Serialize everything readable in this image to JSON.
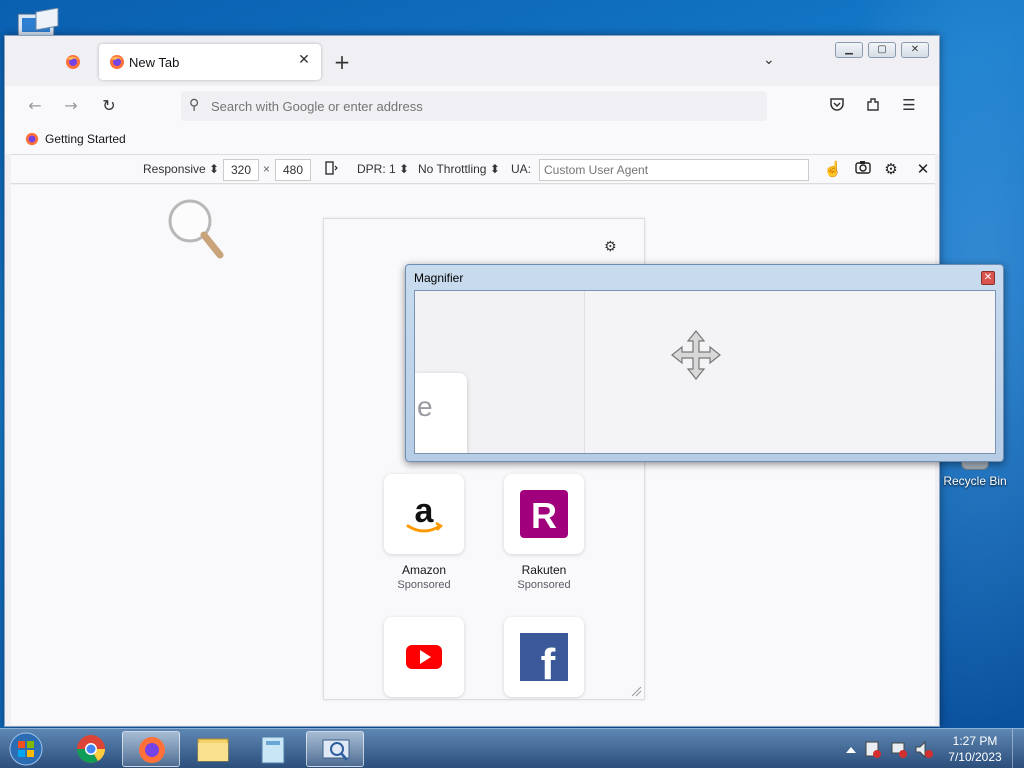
{
  "browser": {
    "tabs": [
      {
        "label": ""
      },
      {
        "label": "New Tab",
        "active": true
      }
    ],
    "new_tab_symbol": "+",
    "urlbar": {
      "placeholder": "Search with Google or enter address",
      "value": ""
    },
    "bookmarks": [
      {
        "label": "Getting Started"
      }
    ],
    "window_controls": [
      "minimize",
      "maximize",
      "close"
    ]
  },
  "responsive_toolbar": {
    "device": "Responsive",
    "width": "320",
    "times": "×",
    "height": "480",
    "dpr": "DPR: 1",
    "throttling": "No Throttling",
    "ua_label": "UA:",
    "ua_placeholder": "Custom User Agent"
  },
  "newtab_page": {
    "tiles": [
      {
        "name": "Amazon",
        "sub": "Sponsored",
        "icon": "amazon-icon"
      },
      {
        "name": "Rakuten",
        "sub": "Sponsored",
        "icon": "rakuten-icon"
      },
      {
        "name": "",
        "sub": "",
        "icon": "youtube-icon"
      },
      {
        "name": "",
        "sub": "",
        "icon": "facebook-icon"
      }
    ]
  },
  "magnifier": {
    "title": "Magnifier",
    "zoomed_text": "e"
  },
  "desktop": {
    "recycle_bin": "Recycle Bin"
  },
  "taskbar": {
    "time": "1:27 PM",
    "date": "7/10/2023"
  },
  "colors": {
    "desktop_blue": "#1479c9",
    "firefox_orange": "#ff7139",
    "amazon_orange": "#ff9900",
    "rakuten_purple": "#a1007d",
    "youtube_red": "#ff0000",
    "facebook_blue": "#3b5998"
  }
}
